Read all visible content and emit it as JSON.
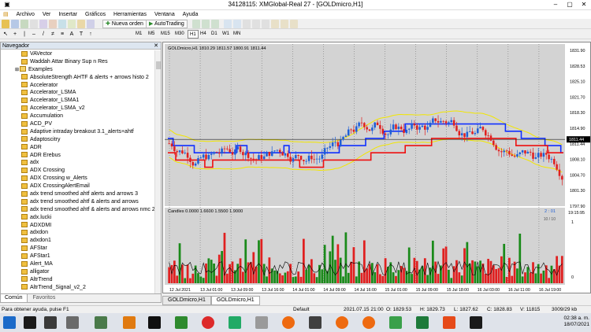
{
  "window": {
    "title": "34128115: XMGlobal-Real 27 - [GOLDmicro,H1]",
    "min": "–",
    "max": "▢",
    "close": "✕"
  },
  "menu": [
    "Archivo",
    "Ver",
    "Insertar",
    "Gráficos",
    "Herramientas",
    "Ventana",
    "Ayuda"
  ],
  "toolbar": {
    "new_order": "Nueva orden",
    "autotrading": "AutoTrading"
  },
  "timeframes": [
    "M1",
    "M5",
    "M15",
    "M30",
    "H1",
    "H4",
    "D1",
    "W1",
    "MN"
  ],
  "navigator": {
    "title": "Navegador",
    "items": [
      "VAVector",
      "Waddah Attar Binary Sup n Res",
      "Examples",
      "AbsoluteStrength AHTF & alerts + arrows histo 2",
      "Accelerator",
      "Accelerator_LSMA",
      "Accelerator_LSMA1",
      "Accelerator_LSMA_v2",
      "Accumulation",
      "ACD_PV",
      "Adaptive intraday breakout 3.1_alerts+ahtf",
      "Adaptoscitry",
      "ADR",
      "ADR Erebus",
      "adx",
      "ADX Crossing",
      "ADX Crossing w_Alerts",
      "ADX CrossingAlertEmail",
      "adx trend smoothed ahtf  alerts and arrows 3",
      "adx trend smoothed ahtf & alerts and arrows",
      "adx trend smoothed ahtf & alerts and arrows nmc 2",
      "adx.lucki",
      "ADXDMI",
      "adxdon",
      "adxdon1",
      "AFStar",
      "AFStar1",
      "Alert_MA",
      "alligator",
      "AltrTrend",
      "AltrTrend_Signal_v2_2"
    ],
    "tabs": [
      "Común",
      "Favoritos"
    ]
  },
  "chart": {
    "header": "GOLDmicro,H1  1810.29 1811.57 1800.91 1811.44",
    "sub_header": "Candles 0.0000 1.6600 1.5500 1.9000",
    "sub_right_top": "2 : 01",
    "sub_right_sub": "10 / 10",
    "current_price": "1811.44",
    "clock": "19:15:95",
    "price_labels": [
      "1831.90",
      "1828.53",
      "1825.10",
      "1821.70",
      "1818.30",
      "1814.90",
      "1811.44",
      "1808.10",
      "1804.70",
      "1801.30",
      "1797.90"
    ],
    "sub_labels": [
      "1",
      "0"
    ],
    "time_labels": [
      "12 Jul 2021",
      "13 Jul 01:00",
      "13 Jul 09:00",
      "13 Jul 16:00",
      "14 Jul 01:00",
      "14 Jul 09:00",
      "14 Jul 16:00",
      "15 Jul 01:00",
      "15 Jul 09:00",
      "15 Jul 18:00",
      "16 Jul 03:00",
      "16 Jul 11:00",
      "16 Jul 19:00"
    ]
  },
  "chart_tabs": [
    "GOLDmicro,H1",
    "GOLDmicro,H1"
  ],
  "status": {
    "hint": "Para obtener ayuda, pulse F1",
    "profile": "Default",
    "datetime": "2021.07.15 21:00",
    "open": "O: 1829.53",
    "high": "H: 1829.73",
    "low": "L: 1827.62",
    "close": "C: 1828.83",
    "volume": "V: 11815",
    "traffic": "3009/29 kb"
  },
  "taskbar": {
    "time": "02:38 a. m.",
    "date": "18/07/2021"
  },
  "colors": {
    "bull": "#1f5fd6",
    "bear": "#e02020",
    "band": "#f2e600",
    "ma_blue": "#1030ff",
    "ma_red": "#ee1010"
  }
}
